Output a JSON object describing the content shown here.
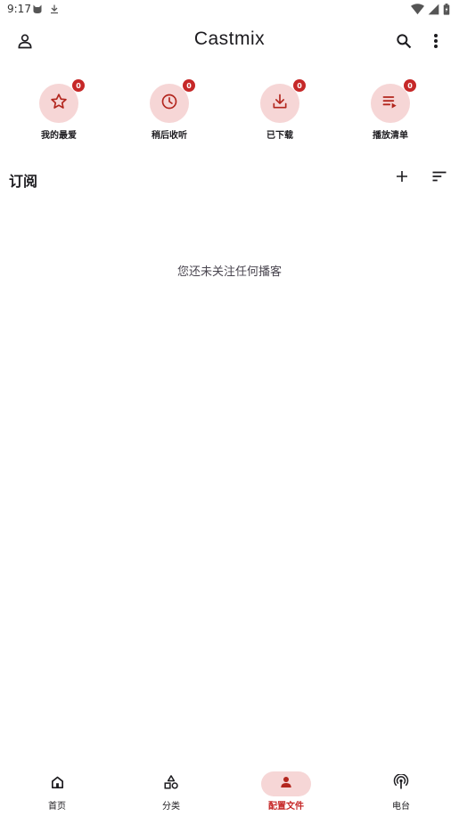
{
  "status_bar": {
    "time": "9:17",
    "left_icons": [
      "cat-notification-icon",
      "download-notification-icon"
    ],
    "right_icons": [
      "wifi-icon",
      "signal-icon",
      "battery-icon"
    ]
  },
  "app_bar": {
    "title": "Castmix",
    "left_icon": "person-outline-icon",
    "right_icons": [
      "search-icon",
      "more-vert-icon"
    ]
  },
  "quick_actions": [
    {
      "label": "我的最爱",
      "badge": "0",
      "icon": "star-outline-icon"
    },
    {
      "label": "稍后收听",
      "badge": "0",
      "icon": "clock-icon"
    },
    {
      "label": "已下载",
      "badge": "0",
      "icon": "download-icon"
    },
    {
      "label": "播放清单",
      "badge": "0",
      "icon": "playlist-play-icon"
    }
  ],
  "subscriptions": {
    "title": "订阅",
    "empty_message": "您还未关注任何播客",
    "actions": [
      "add-icon",
      "sort-icon"
    ]
  },
  "bottom_nav": {
    "items": [
      {
        "label": "首页",
        "icon": "home-icon"
      },
      {
        "label": "分类",
        "icon": "category-shapes-icon"
      },
      {
        "label": "配置文件",
        "icon": "person-icon",
        "active": true
      },
      {
        "label": "电台",
        "icon": "radio-tower-icon"
      }
    ]
  },
  "colors": {
    "accent": "#c62828",
    "accent_container": "#f6d6d6",
    "icon": "#b3261e",
    "text": "#1c1b1f",
    "secondary_text": "#49454f",
    "background": "#ffffff"
  }
}
